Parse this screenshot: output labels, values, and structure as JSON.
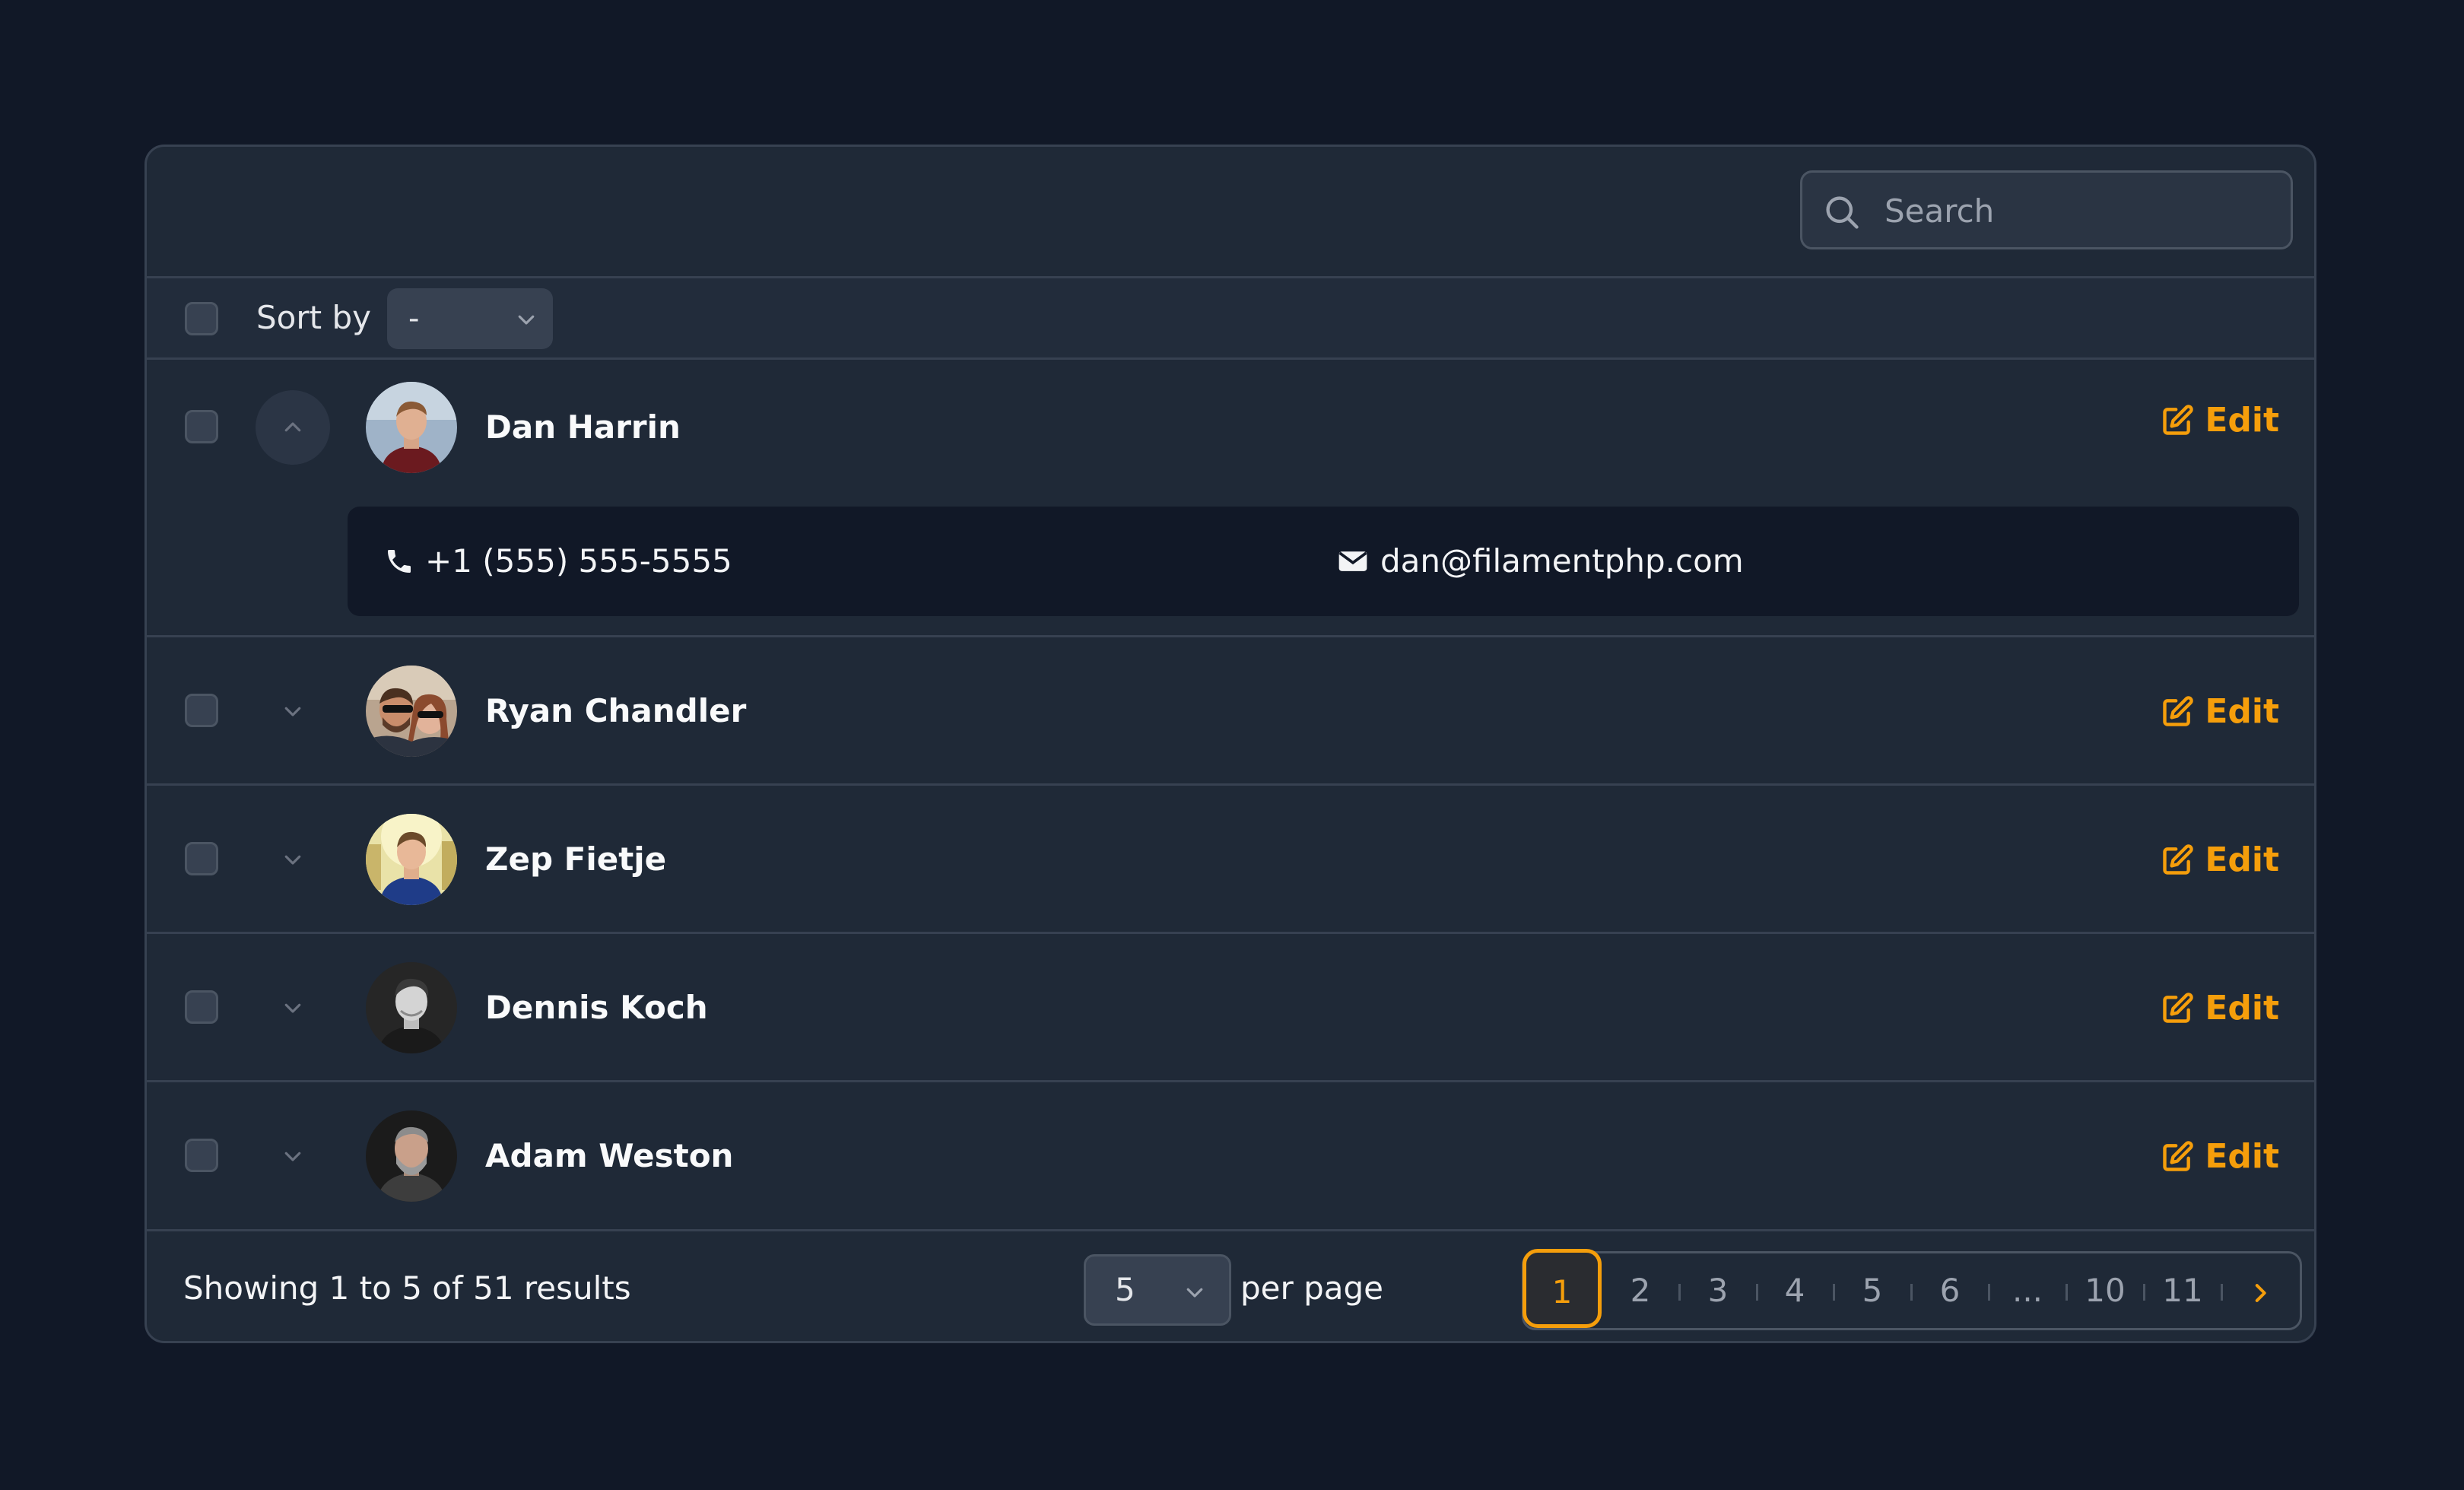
{
  "search": {
    "placeholder": "Search"
  },
  "sort": {
    "label": "Sort by",
    "selected": "-"
  },
  "rows": [
    {
      "name": "Dan Harrin",
      "expanded": true,
      "phone": "+1 (555) 555-5555",
      "email": "dan@filamentphp.com",
      "edit_label": "Edit"
    },
    {
      "name": "Ryan Chandler",
      "expanded": false,
      "edit_label": "Edit"
    },
    {
      "name": "Zep Fietje",
      "expanded": false,
      "edit_label": "Edit"
    },
    {
      "name": "Dennis Koch",
      "expanded": false,
      "edit_label": "Edit"
    },
    {
      "name": "Adam Weston",
      "expanded": false,
      "edit_label": "Edit"
    }
  ],
  "footer": {
    "showing_text": "Showing 1 to 5 of 51 results",
    "per_page_value": "5",
    "per_page_label": "per page"
  },
  "pagination": {
    "pages": [
      "1",
      "2",
      "3",
      "4",
      "5",
      "6",
      "...",
      "10",
      "11"
    ],
    "active_page": "1",
    "next_icon": "chevron-right-icon"
  },
  "colors": {
    "accent": "#f59e0b",
    "background": "#111827",
    "card": "#1f2937",
    "border": "#374151"
  }
}
